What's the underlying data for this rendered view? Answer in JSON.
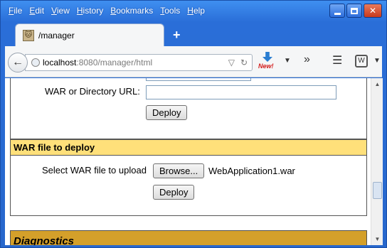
{
  "menu": [
    "File",
    "Edit",
    "View",
    "History",
    "Bookmarks",
    "Tools",
    "Help"
  ],
  "menu_underline": [
    "F",
    "E",
    "V",
    "H",
    "B",
    "T",
    "H"
  ],
  "tab": {
    "title": "/manager"
  },
  "newtab_label": "+",
  "url": {
    "host": "localhost",
    "rest": ":8080/manager/html"
  },
  "toolbar": {
    "download_badge": "New!",
    "overflow": "»"
  },
  "deploy_dir": {
    "war_url_label": "WAR or Directory URL:",
    "war_url_value": "",
    "deploy_button": "Deploy"
  },
  "war_upload": {
    "header": "WAR file to deploy",
    "select_label": "Select WAR file to upload",
    "browse_button": "Browse...",
    "file_name": "WebApplication1.war",
    "deploy_button": "Deploy"
  },
  "diagnostics": {
    "title": "Diagnostics"
  },
  "colors": {
    "window_blue": "#2a6ed8",
    "section_yellow": "#ffe07a",
    "diag_gold": "#d4a02a"
  }
}
